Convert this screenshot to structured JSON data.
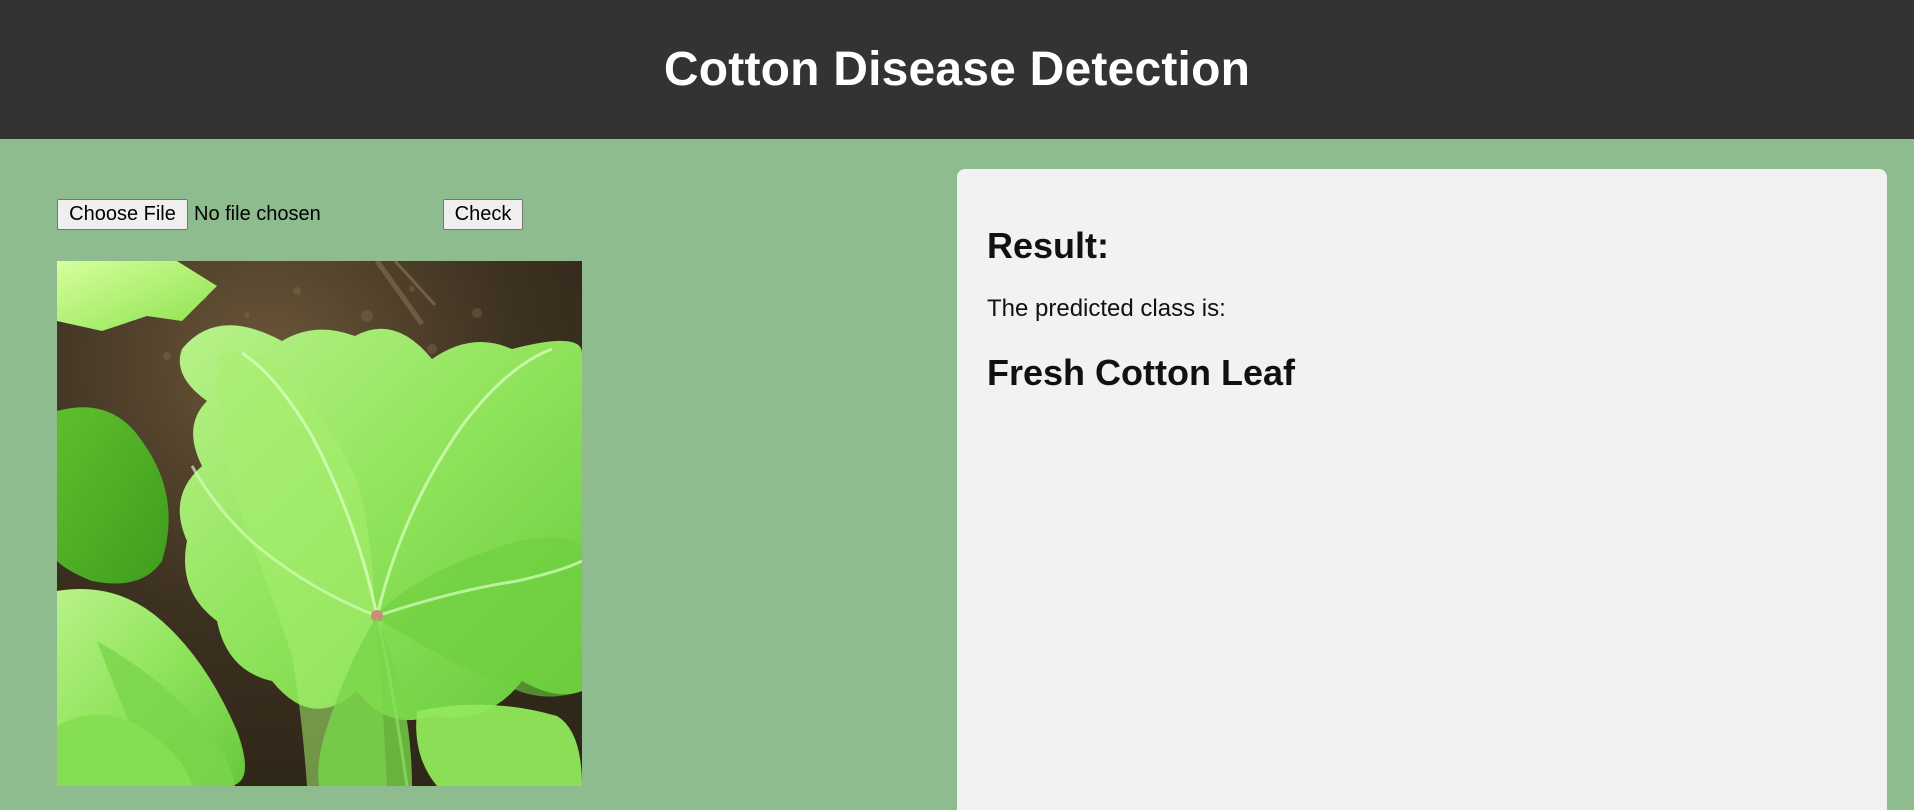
{
  "header": {
    "title": "Cotton Disease Detection"
  },
  "upload": {
    "choose_label": "Choose File",
    "file_status": "No file chosen",
    "check_label": "Check"
  },
  "preview": {
    "icon": "cotton-leaf-photo"
  },
  "result": {
    "title": "Result:",
    "intro": "The predicted class is:",
    "predicted_class": "Fresh Cotton Leaf"
  },
  "colors": {
    "background": "#8fbc8f",
    "header": "#333333",
    "panel": "#f2f2f2"
  }
}
